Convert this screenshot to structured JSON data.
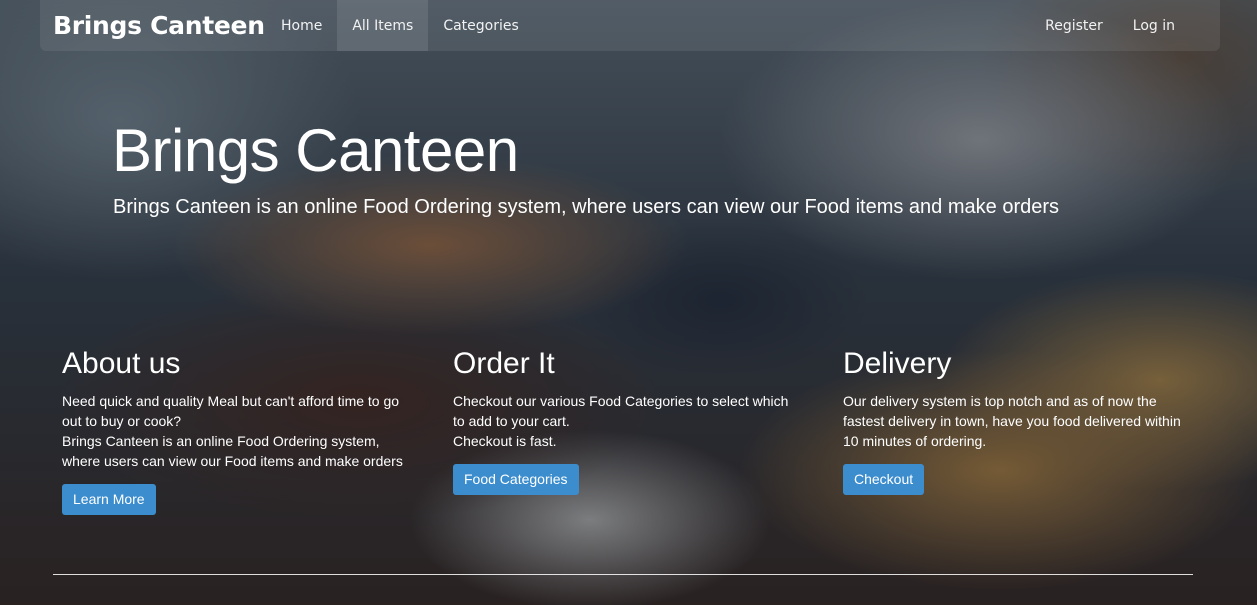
{
  "navbar": {
    "brand": "Brings Canteen",
    "links": [
      {
        "label": "Home"
      },
      {
        "label": "All Items"
      },
      {
        "label": "Categories"
      }
    ],
    "right_links": [
      {
        "label": "Register"
      },
      {
        "label": "Log in"
      }
    ]
  },
  "hero": {
    "title": "Brings Canteen",
    "subtitle": "Brings Canteen is an online Food Ordering system, where users can view our Food items and make orders"
  },
  "columns": [
    {
      "heading": "About us",
      "lines": [
        "Need quick and quality Meal but can't afford time to go out to buy or cook?",
        "Brings Canteen is an online Food Ordering system, where users can view our Food items and make orders"
      ],
      "button": "Learn More"
    },
    {
      "heading": "Order It",
      "lines": [
        "Checkout our various Food Categories to select which to add to your cart.",
        "Checkout is fast."
      ],
      "button": "Food Categories"
    },
    {
      "heading": "Delivery",
      "lines": [
        "Our delivery system is top notch and as of now the fastest delivery in town, have you food delivered within 10 minutes of ordering."
      ],
      "button": "Checkout"
    }
  ],
  "colors": {
    "button": "#3c8dce",
    "text": "#ffffff"
  }
}
